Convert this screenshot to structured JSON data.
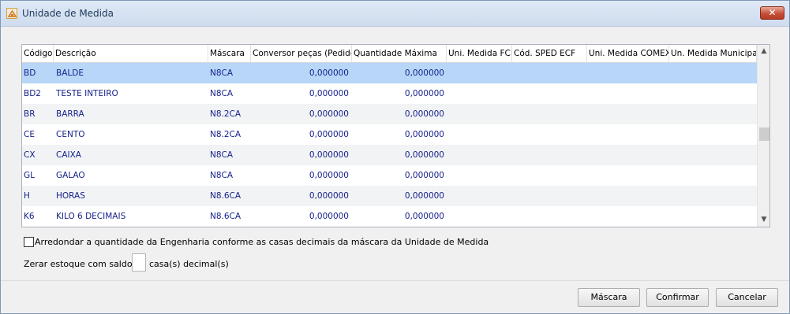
{
  "window": {
    "title": "Unidade de Medida",
    "close_label": "✕"
  },
  "grid": {
    "columns": [
      "Código",
      "Descrição",
      "Máscara",
      "Conversor peças (Pedido)",
      "Quantidade Máxima",
      "Uni. Medida FCI",
      "Cód. SPED ECF",
      "Uni. Medida COMEX",
      "Un. Medida Municipal"
    ],
    "rows": [
      {
        "codigo": "BD",
        "descricao": "BALDE",
        "mascara": "N8CA",
        "conversor": "0,000000",
        "qtd_max": "0,000000",
        "selected": true
      },
      {
        "codigo": "BD2",
        "descricao": "TESTE INTEIRO",
        "mascara": "N8CA",
        "conversor": "0,000000",
        "qtd_max": "0,000000"
      },
      {
        "codigo": "BR",
        "descricao": "BARRA",
        "mascara": "N8.2CA",
        "conversor": "0,000000",
        "qtd_max": "0,000000"
      },
      {
        "codigo": "CE",
        "descricao": "CENTO",
        "mascara": "N8.2CA",
        "conversor": "0,000000",
        "qtd_max": "0,000000"
      },
      {
        "codigo": "CX",
        "descricao": "CAIXA",
        "mascara": "N8CA",
        "conversor": "0,000000",
        "qtd_max": "0,000000"
      },
      {
        "codigo": "GL",
        "descricao": "GALAO",
        "mascara": "N8CA",
        "conversor": "0,000000",
        "qtd_max": "0,000000"
      },
      {
        "codigo": "H",
        "descricao": "HORAS",
        "mascara": "N8.6CA",
        "conversor": "0,000000",
        "qtd_max": "0,000000"
      },
      {
        "codigo": "K6",
        "descricao": "KILO 6 DECIMAIS",
        "mascara": "N8.6CA",
        "conversor": "0,000000",
        "qtd_max": "0,000000"
      }
    ]
  },
  "options": {
    "arredondar_label": "Arredondar a quantidade da Engenharia conforme as casas decimais da máscara da Unidade de Medida",
    "arredondar_checked": false,
    "zerar_label": "Zerar estoque com saldo na",
    "casas_value": "",
    "casas_label": "casa(s) decimal(s)"
  },
  "buttons": {
    "mascara": "Máscara",
    "confirmar": "Confirmar",
    "cancelar": "Cancelar"
  },
  "colors": {
    "selected_row": "#b7d6f8",
    "row_text": "#17228a"
  }
}
